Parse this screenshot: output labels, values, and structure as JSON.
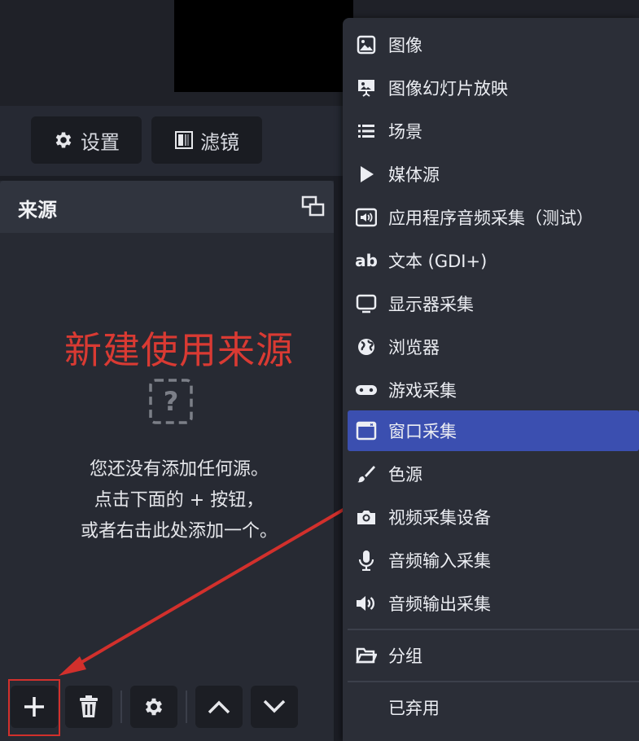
{
  "toolbar": {
    "settings_label": "设置",
    "filters_label": "滤镜"
  },
  "sources_panel": {
    "title": "来源",
    "empty_title": "新建使用来源",
    "empty_lines": [
      "您还没有添加任何源。",
      "点击下面的 + 按钮，",
      "或者右击此处添加一个。"
    ]
  },
  "menu": {
    "items": [
      {
        "label": "图像",
        "icon": "image-icon"
      },
      {
        "label": "图像幻灯片放映",
        "icon": "slideshow-icon"
      },
      {
        "label": "场景",
        "icon": "list-icon"
      },
      {
        "label": "媒体源",
        "icon": "play-icon"
      },
      {
        "label": "应用程序音频采集（测试）",
        "icon": "app-audio-icon"
      },
      {
        "label": "文本 (GDI+)",
        "icon": "text-icon"
      },
      {
        "label": "显示器采集",
        "icon": "monitor-icon"
      },
      {
        "label": "浏览器",
        "icon": "globe-icon"
      },
      {
        "label": "游戏采集",
        "icon": "gamepad-icon"
      },
      {
        "label": "窗口采集",
        "icon": "window-icon"
      },
      {
        "label": "色源",
        "icon": "brush-icon"
      },
      {
        "label": "视频采集设备",
        "icon": "camera-icon"
      },
      {
        "label": "音频输入采集",
        "icon": "microphone-icon"
      },
      {
        "label": "音频输出采集",
        "icon": "speaker-icon"
      },
      {
        "label": "分组",
        "icon": "folder-icon"
      },
      {
        "label": "已弃用",
        "icon": ""
      }
    ],
    "selected": "窗口采集"
  },
  "colors": {
    "accent": "#3b4fb0",
    "empty_title": "#d93a33",
    "highlight": "#d2302c"
  }
}
